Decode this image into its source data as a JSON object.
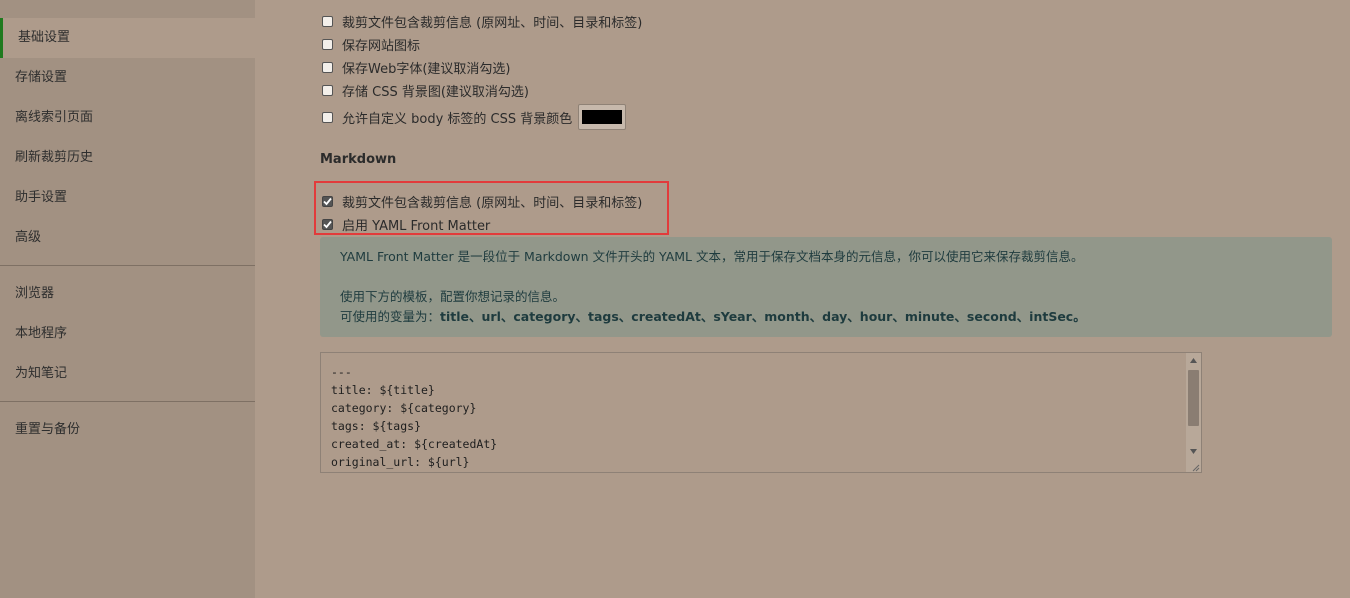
{
  "sidebar": {
    "items": [
      {
        "label": "基础设置",
        "active": true
      },
      {
        "label": "存储设置"
      },
      {
        "label": "离线索引页面"
      },
      {
        "label": "刷新裁剪历史"
      },
      {
        "label": "助手设置"
      },
      {
        "label": "高级"
      },
      {
        "label": "浏览器"
      },
      {
        "label": "本地程序"
      },
      {
        "label": "为知笔记"
      },
      {
        "label": "重置与备份"
      }
    ]
  },
  "html_options": [
    {
      "label": "裁剪文件包含裁剪信息 (原网址、时间、目录和标签)",
      "checked": false
    },
    {
      "label": "保存网站图标",
      "checked": false
    },
    {
      "label": "保存Web字体(建议取消勾选)",
      "checked": false
    },
    {
      "label": "存储 CSS 背景图(建议取消勾选)",
      "checked": false
    },
    {
      "label": "允许自定义 body 标签的 CSS 背景颜色",
      "checked": false
    }
  ],
  "bg_color": "#000000",
  "markdown": {
    "title": "Markdown",
    "options": [
      {
        "label": "裁剪文件包含裁剪信息 (原网址、时间、目录和标签)",
        "checked": true
      },
      {
        "label": "启用 YAML Front Matter",
        "checked": true
      }
    ],
    "info": {
      "line1": "YAML Front Matter 是一段位于 Markdown 文件开头的 YAML 文本，常用于保存文档本身的元信息，你可以使用它来保存裁剪信息。",
      "line2": "使用下方的模板，配置你想记录的信息。",
      "line3_prefix": "可使用的变量为：",
      "line3_vars": "title、url、category、tags、createdAt、sYear、month、day、hour、minute、second、intSec。"
    },
    "template": "---\ntitle: ${title}\ncategory: ${category}\ntags: ${tags}\ncreated_at: ${createdAt}\noriginal_url: ${url}"
  },
  "colors": {
    "highlight_border": "#e23b3b",
    "active_indicator": "#1f7a1f"
  }
}
